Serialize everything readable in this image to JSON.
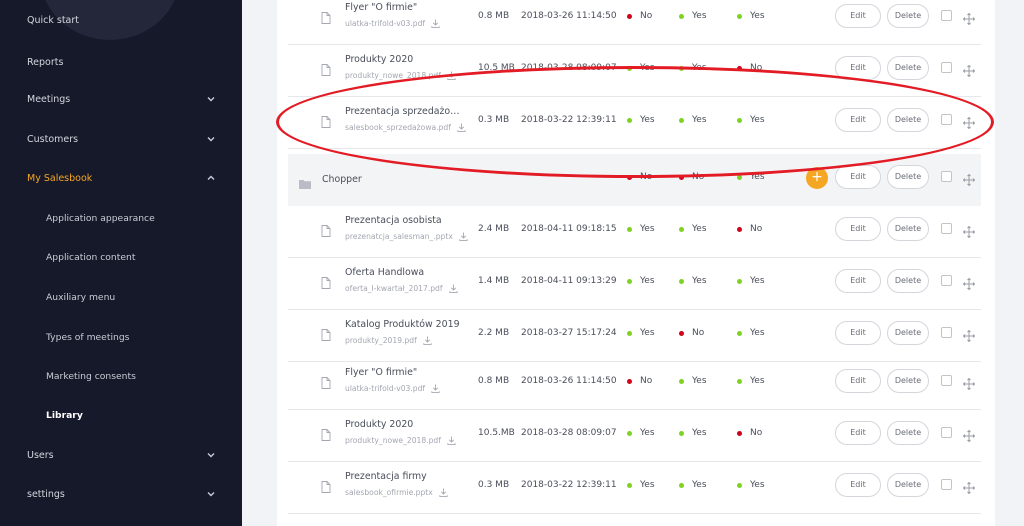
{
  "sidebar": {
    "items": [
      {
        "label": "Quick start"
      },
      {
        "label": "Reports"
      },
      {
        "label": "Meetings"
      },
      {
        "label": "Customers"
      },
      {
        "label": "My Salesbook"
      },
      {
        "label": "Application appearance"
      },
      {
        "label": "Application content"
      },
      {
        "label": "Auxiliary menu"
      },
      {
        "label": "Types of meetings"
      },
      {
        "label": "Marketing consents"
      },
      {
        "label": "Library"
      },
      {
        "label": "Users"
      },
      {
        "label": "settings"
      }
    ]
  },
  "buttons": {
    "edit": "Edit",
    "delete": "Delete",
    "add": "+"
  },
  "colors": {
    "accent": "#f5a623",
    "yes": "#7ed321",
    "no": "#d0021b",
    "annotation": "#e21b24"
  },
  "rows": [
    {
      "name": "Flyer \"O firmie\"",
      "file": "ulatka-trifold-v03.pdf",
      "size": "0.8 MB",
      "date": "2018-03-26 11:14:50",
      "f1": "No",
      "f2": "Yes",
      "f3": "Yes"
    },
    {
      "name": "Produkty 2020",
      "file": "produkty_nowe_2018.pdf",
      "size": "10.5 MB",
      "date": "2018-03-28 08:09:07",
      "f1": "Yes",
      "f2": "Yes",
      "f3": "No"
    },
    {
      "name": "Prezentacja sprzedażow...",
      "file": "salesbook_sprzedażowa.pdf",
      "size": "0.3 MB",
      "date": "2018-03-22 12:39:11",
      "f1": "Yes",
      "f2": "Yes",
      "f3": "Yes"
    },
    {
      "folder": true,
      "name": "Chopper",
      "f1": "No",
      "f2": "No",
      "f3": "Yes"
    },
    {
      "name": "Prezentacja osobista",
      "file": "prezenatcja_salesman_.pptx",
      "size": "2.4 MB",
      "date": "2018-04-11 09:18:15",
      "f1": "Yes",
      "f2": "Yes",
      "f3": "No"
    },
    {
      "name": "Oferta Handlowa",
      "file": "oferta_I-kwartał_2017.pdf",
      "size": "1.4 MB",
      "date": "2018-04-11 09:13:29",
      "f1": "Yes",
      "f2": "Yes",
      "f3": "Yes"
    },
    {
      "name": "Katalog Produktów 2019",
      "file": "produkty_2019.pdf",
      "size": "2.2 MB",
      "date": "2018-03-27 15:17:24",
      "f1": "Yes",
      "f2": "No",
      "f3": "Yes"
    },
    {
      "name": "Flyer \"O firmie\"",
      "file": "ulatka-trifold-v03.pdf",
      "size": "0.8 MB",
      "date": "2018-03-26 11:14:50",
      "f1": "No",
      "f2": "Yes",
      "f3": "Yes"
    },
    {
      "name": "Produkty 2020",
      "file": "produkty_nowe_2018.pdf",
      "size": "10.5.MB",
      "date": "2018-03-28 08:09:07",
      "f1": "Yes",
      "f2": "Yes",
      "f3": "No"
    },
    {
      "name": "Prezentacja firmy",
      "file": "salesbook_ofirmie.pptx",
      "size": "0.3 MB",
      "date": "2018-03-22 12:39:11",
      "f1": "Yes",
      "f2": "Yes",
      "f3": "Yes"
    }
  ]
}
